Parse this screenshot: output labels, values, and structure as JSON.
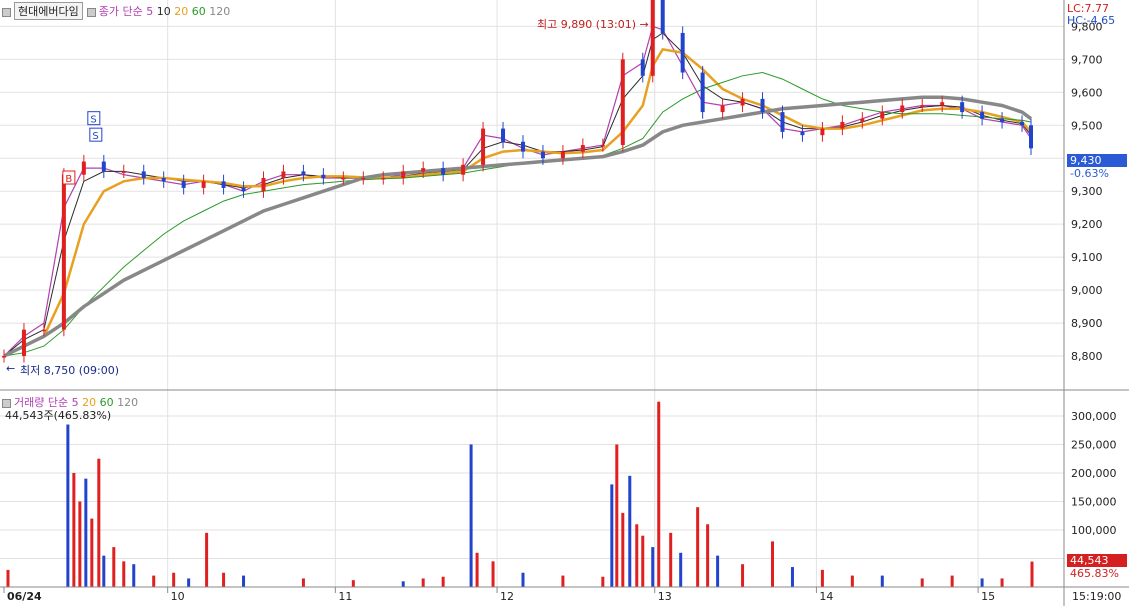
{
  "legend": {
    "stock_name": "현대에버다임",
    "ma_title": "종가 단순",
    "periods": [
      "5",
      "10",
      "20",
      "60",
      "120"
    ]
  },
  "volume_legend": {
    "title": "거래량 단순",
    "periods": [
      "5",
      "20",
      "60",
      "120"
    ],
    "info": "44,543주(465.83%)"
  },
  "right_info": {
    "lc": "LC:7.77",
    "hc": "HC:-4.65",
    "current_price": "9,430",
    "current_change": "-0.63%",
    "current_volume": "44,543",
    "volume_pct": "465.83%"
  },
  "annotations": {
    "high": "최고 9,890 (13:01)",
    "low": "최저 8,750 (09:00)",
    "markers": [
      "S",
      "S",
      "B"
    ]
  },
  "time": "15:19:00",
  "colors": {
    "up": "#e02020",
    "down": "#2244cc",
    "ma5": "#b040b0",
    "ma10": "#2a2a2a",
    "ma20": "#e8a020",
    "ma60": "#2a9a2a",
    "ma120": "#888888",
    "grid": "#e2e2e2"
  },
  "chart_data": [
    {
      "type": "candlestick",
      "title": "현대에버다임",
      "x_ticks": [
        "06/24",
        "10",
        "11",
        "12",
        "13",
        "14",
        "15"
      ],
      "y_ticks": [
        8800,
        8900,
        9000,
        9100,
        9200,
        9300,
        9400,
        9500,
        9600,
        9700,
        9800
      ],
      "y_tick_labels": [
        "8,800",
        "8,900",
        "9,000",
        "9,100",
        "9,200",
        "9,300",
        "9,400",
        "9,500",
        "9,600",
        "9,700",
        "9,800"
      ],
      "ylim": [
        8700,
        9880
      ],
      "x_points": [
        0,
        20,
        40,
        60,
        80,
        100,
        120,
        140,
        160,
        180,
        200,
        220,
        240,
        260,
        280,
        300,
        320,
        340,
        360,
        380,
        400,
        420,
        440,
        460,
        480,
        500,
        520,
        540,
        560,
        580,
        600,
        620,
        640,
        650,
        660,
        680,
        700,
        720,
        740,
        760,
        780,
        800,
        820,
        840,
        860,
        880,
        900,
        920,
        940,
        960,
        980,
        1000,
        1020,
        1029
      ],
      "xlim": [
        0,
        1029
      ],
      "x_tick_positions": [
        0,
        164,
        332,
        494,
        652,
        814,
        976
      ],
      "close": [
        8800,
        8880,
        8880,
        9350,
        9390,
        9360,
        9360,
        9340,
        9330,
        9310,
        9330,
        9310,
        9300,
        9340,
        9360,
        9350,
        9340,
        9340,
        9340,
        9340,
        9360,
        9370,
        9350,
        9380,
        9490,
        9450,
        9420,
        9400,
        9420,
        9440,
        9440,
        9700,
        9650,
        9880,
        9780,
        9660,
        9540,
        9560,
        9580,
        9540,
        9480,
        9470,
        9490,
        9510,
        9520,
        9540,
        9560,
        9560,
        9570,
        9540,
        9520,
        9510,
        9500,
        9430
      ],
      "ma_series": [
        {
          "name": "5",
          "values": [
            8800,
            8860,
            8900,
            9250,
            9370,
            9370,
            9350,
            9340,
            9330,
            9320,
            9330,
            9320,
            9300,
            9330,
            9350,
            9350,
            9340,
            9340,
            9340,
            9340,
            9350,
            9360,
            9360,
            9370,
            9470,
            9460,
            9430,
            9410,
            9420,
            9430,
            9440,
            9650,
            9690,
            9800,
            9790,
            9680,
            9570,
            9560,
            9570,
            9550,
            9490,
            9480,
            9490,
            9500,
            9520,
            9540,
            9550,
            9560,
            9560,
            9550,
            9520,
            9510,
            9500,
            9460
          ]
        },
        {
          "name": "10",
          "values": [
            8800,
            8850,
            8880,
            9150,
            9330,
            9360,
            9360,
            9350,
            9340,
            9330,
            9330,
            9320,
            9310,
            9320,
            9340,
            9350,
            9345,
            9340,
            9340,
            9340,
            9345,
            9355,
            9360,
            9365,
            9430,
            9450,
            9440,
            9420,
            9420,
            9425,
            9435,
            9580,
            9650,
            9760,
            9780,
            9720,
            9620,
            9580,
            9570,
            9550,
            9510,
            9490,
            9490,
            9495,
            9510,
            9530,
            9545,
            9555,
            9560,
            9555,
            9530,
            9515,
            9505,
            9470
          ]
        },
        {
          "name": "20",
          "values": [
            8800,
            8830,
            8860,
            8990,
            9200,
            9300,
            9330,
            9340,
            9340,
            9335,
            9330,
            9325,
            9315,
            9315,
            9330,
            9340,
            9345,
            9345,
            9342,
            9340,
            9342,
            9350,
            9355,
            9360,
            9400,
            9420,
            9425,
            9420,
            9415,
            9418,
            9425,
            9480,
            9560,
            9680,
            9730,
            9720,
            9670,
            9610,
            9580,
            9560,
            9530,
            9500,
            9490,
            9490,
            9500,
            9515,
            9530,
            9545,
            9550,
            9550,
            9540,
            9525,
            9510,
            9480
          ]
        },
        {
          "name": "60",
          "values": [
            8800,
            8810,
            8830,
            8880,
            8950,
            9010,
            9070,
            9120,
            9170,
            9210,
            9240,
            9270,
            9290,
            9300,
            9310,
            9320,
            9325,
            9330,
            9335,
            9338,
            9340,
            9345,
            9350,
            9355,
            9365,
            9375,
            9385,
            9392,
            9398,
            9402,
            9408,
            9430,
            9460,
            9500,
            9540,
            9580,
            9610,
            9630,
            9650,
            9660,
            9640,
            9610,
            9580,
            9560,
            9550,
            9540,
            9535,
            9535,
            9535,
            9530,
            9525,
            9520,
            9515,
            9510
          ]
        },
        {
          "name": "120",
          "values": [
            8800,
            8830,
            8860,
            8900,
            8950,
            8990,
            9030,
            9060,
            9090,
            9120,
            9150,
            9180,
            9210,
            9240,
            9260,
            9280,
            9300,
            9320,
            9340,
            9350,
            9355,
            9360,
            9365,
            9370,
            9375,
            9380,
            9385,
            9390,
            9395,
            9400,
            9405,
            9420,
            9440,
            9460,
            9480,
            9500,
            9510,
            9520,
            9530,
            9540,
            9550,
            9555,
            9560,
            9565,
            9570,
            9575,
            9580,
            9585,
            9585,
            9580,
            9570,
            9560,
            9540,
            9520
          ]
        }
      ]
    },
    {
      "type": "bar",
      "title": "거래량",
      "y_ticks": [
        50000,
        100000,
        150000,
        200000,
        250000,
        300000
      ],
      "y_tick_labels": [
        "50,000",
        "100,000",
        "150,000",
        "200,000",
        "250,000",
        "300,000"
      ],
      "ylim": [
        0,
        335000
      ],
      "x_points": [
        4,
        64,
        70,
        76,
        82,
        88,
        95,
        100,
        110,
        120,
        130,
        150,
        170,
        185,
        203,
        220,
        240,
        300,
        350,
        400,
        420,
        440,
        468,
        474,
        490,
        520,
        560,
        600,
        609,
        614,
        620,
        627,
        634,
        640,
        650,
        656,
        668,
        678,
        695,
        705,
        715,
        740,
        770,
        790,
        820,
        850,
        880,
        920,
        950,
        980,
        1000,
        1030
      ],
      "values": [
        30000,
        285000,
        200000,
        150000,
        190000,
        120000,
        225000,
        55000,
        70000,
        45000,
        40000,
        20000,
        25000,
        15000,
        95000,
        25000,
        20000,
        15000,
        12000,
        10000,
        15000,
        18000,
        250000,
        60000,
        45000,
        25000,
        20000,
        18000,
        180000,
        250000,
        130000,
        195000,
        110000,
        90000,
        70000,
        325000,
        95000,
        60000,
        140000,
        110000,
        55000,
        40000,
        80000,
        35000,
        30000,
        20000,
        20000,
        15000,
        20000,
        15000,
        15000,
        44543
      ]
    }
  ]
}
